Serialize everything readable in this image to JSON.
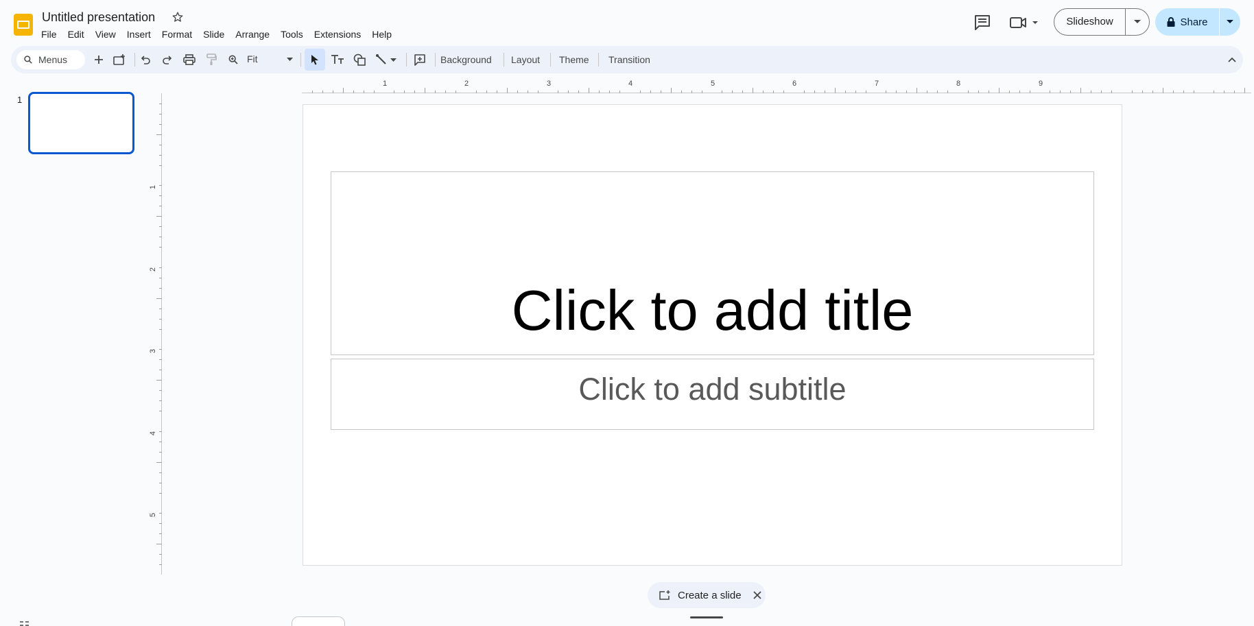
{
  "header": {
    "title": "Untitled presentation",
    "menus": [
      "File",
      "Edit",
      "View",
      "Insert",
      "Format",
      "Slide",
      "Arrange",
      "Tools",
      "Extensions",
      "Help"
    ],
    "slideshow_label": "Slideshow",
    "share_label": "Share"
  },
  "toolbar": {
    "search_placeholder": "Menus",
    "zoom": "Fit",
    "background_label": "Background",
    "layout_label": "Layout",
    "theme_label": "Theme",
    "transition_label": "Transition"
  },
  "filmstrip": {
    "slides": [
      {
        "number": "1"
      }
    ]
  },
  "rulers": {
    "horizontal": [
      "1",
      "2",
      "3",
      "4",
      "5",
      "6",
      "7",
      "8",
      "9"
    ],
    "vertical": [
      "1",
      "2",
      "3",
      "4",
      "5"
    ]
  },
  "slide": {
    "title_placeholder": "Click to add title",
    "subtitle_placeholder": "Click to add subtitle"
  },
  "bottom": {
    "create_slide_label": "Create a slide"
  },
  "colors": {
    "accent": "#0b57d0",
    "share_bg": "#c2e7ff",
    "toolbar_bg": "#edf2fa",
    "logo": "#f4b400"
  }
}
